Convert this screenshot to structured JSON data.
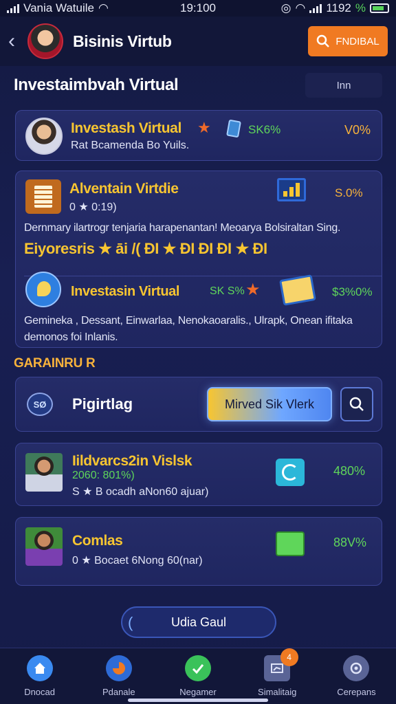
{
  "status_bar": {
    "carrier": "Vania Watuile",
    "time": "19:100",
    "battery_text": "1192",
    "battery_pct_symbol": "%"
  },
  "header": {
    "title": "Bisinis Virtub",
    "action_label": "FNDIBAL"
  },
  "section": {
    "title": "Investaimbvah Virtual",
    "filter_label": "Inn"
  },
  "card1": {
    "title": "Investash Virtual",
    "subtitle": "Rat Bcamenda Bo Yuils.",
    "metric": "SK6%",
    "percent": "V0%"
  },
  "card2": {
    "title": "Alventain Virtdie",
    "rating_line": "0 ★ 0:19)",
    "percent": "S.0%",
    "description": "Dernmary ilartrogr tenjaria harapenantan! Meoarya Bolsiraltan Sing.",
    "rating_text": "Eiyoresris ★ āi /( ĐI ★ ĐI ĐI  ĐI ★ ĐI",
    "sub_title": "Investasin Virtual",
    "sub_metric": "SK S%",
    "sub_percent": "$3%0%",
    "sub_description": "Gemineka , Dessant, Einwarlaa, Nenokaoaralis., Ulrapk, Onean ifitaka demonos foi Inlanis."
  },
  "group_label": "GARAINRU R",
  "search_card": {
    "title": "Pigirtlag",
    "input_value": "Mirved Sik Vlerk",
    "logo_text": "SØ"
  },
  "card4": {
    "title": "Iildvarcs2in Vislsk",
    "sub": "2060: 801%)",
    "detail": "S ★ B ocadh aNon60 ajuar)",
    "percent": "480%"
  },
  "card5": {
    "title": "Comlas",
    "detail": "0 ★ Bocaet 6Nong 60(nar)",
    "percent": "88V%"
  },
  "pill_button": {
    "label": "Udia Gaul"
  },
  "tabbar": {
    "items": [
      {
        "label": "Dnocad",
        "icon": "home-icon",
        "color": "#3a8af0"
      },
      {
        "label": "Pdanale",
        "icon": "chart-icon",
        "color": "#f07a22"
      },
      {
        "label": "Negamer",
        "icon": "check-icon",
        "color": "#3ac25a"
      },
      {
        "label": "Simalitaig",
        "icon": "message-icon",
        "color": "#5a6496",
        "badge": "4"
      },
      {
        "label": "Cerepans",
        "icon": "group-icon",
        "color": "#5a6496"
      }
    ]
  }
}
